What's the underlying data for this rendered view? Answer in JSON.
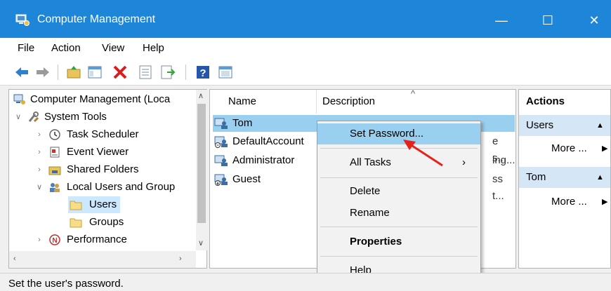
{
  "window": {
    "title": "Computer Management"
  },
  "menu": [
    "File",
    "Action",
    "View",
    "Help"
  ],
  "toolbar_icons": [
    "back-icon",
    "forward-icon",
    "up-folder-icon",
    "show-hide-tree-icon",
    "delete-icon",
    "properties-icon",
    "export-icon",
    "help-icon",
    "console-icon"
  ],
  "tree": {
    "items": [
      {
        "label": "Computer Management (Loca",
        "icon": "computer-icon"
      },
      {
        "label": "System Tools",
        "icon": "tools-icon",
        "expanded": true
      },
      {
        "label": "Task Scheduler",
        "icon": "clock-icon"
      },
      {
        "label": "Event Viewer",
        "icon": "event-viewer-icon"
      },
      {
        "label": "Shared Folders",
        "icon": "shared-folder-icon"
      },
      {
        "label": "Local Users and Group",
        "icon": "users-group-icon",
        "expanded": true
      },
      {
        "label": "Users",
        "icon": "folder-icon",
        "selected": true
      },
      {
        "label": "Groups",
        "icon": "folder-icon"
      },
      {
        "label": "Performance",
        "icon": "performance-icon"
      }
    ]
  },
  "list": {
    "columns": {
      "name": "Name",
      "description": "Description"
    },
    "rows": [
      {
        "name": "Tom",
        "desc": "",
        "selected": true
      },
      {
        "name": "DefaultAccount",
        "desc": "e s..."
      },
      {
        "name": "Administrator",
        "desc": "ing..."
      },
      {
        "name": "Guest",
        "desc": "ss t..."
      }
    ]
  },
  "actions": {
    "title": "Actions",
    "sections": [
      {
        "title": "Users",
        "more": "More ..."
      },
      {
        "title": "Tom",
        "more": "More ..."
      }
    ]
  },
  "context_menu": {
    "set_password": "Set Password...",
    "all_tasks": "All Tasks",
    "delete": "Delete",
    "rename": "Rename",
    "properties": "Properties",
    "help": "Help"
  },
  "status": {
    "text": "Set the user's password."
  },
  "colors": {
    "titlebar": "#1d86d9",
    "selection": "#99cfef",
    "action_section": "#d5e6f6",
    "annotation_arrow": "#e8201a"
  }
}
